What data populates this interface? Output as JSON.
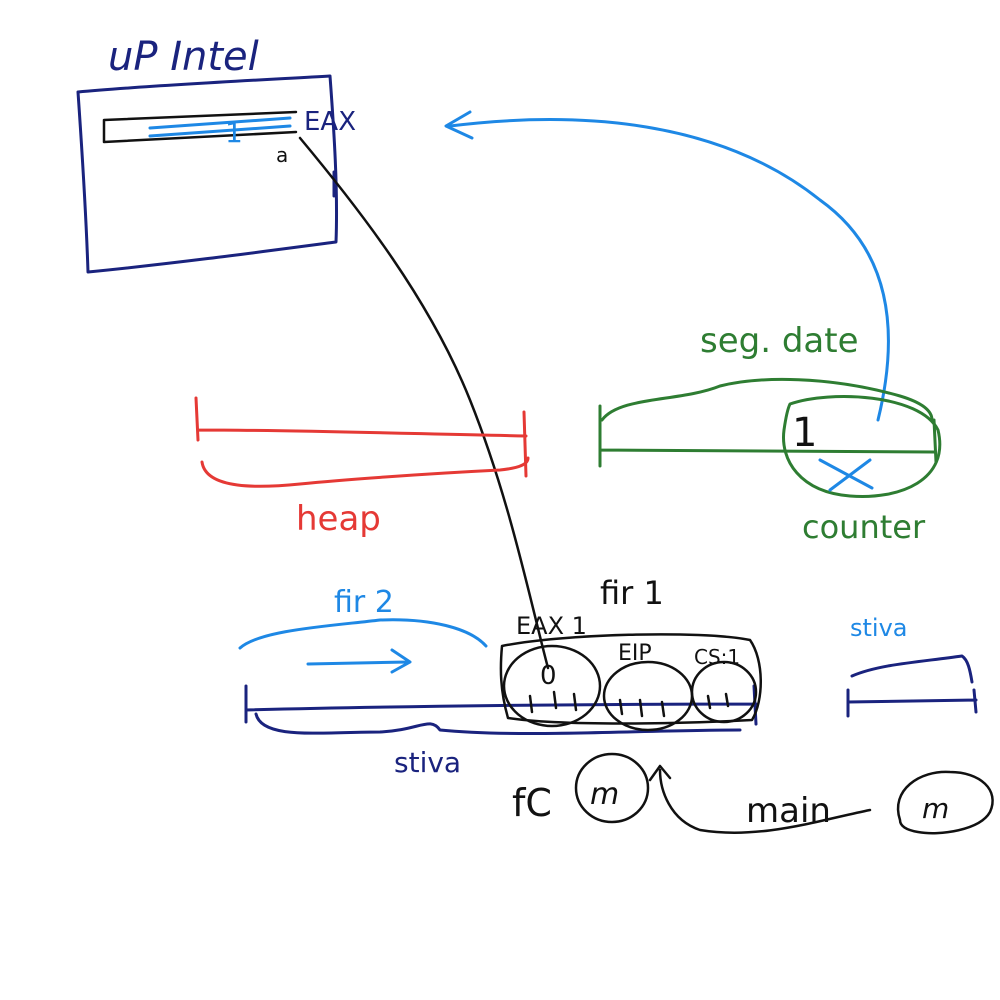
{
  "colors": {
    "navy": "#1a237e",
    "blue": "#1e88e5",
    "red": "#e53935",
    "green": "#2e7d32",
    "black": "#111111",
    "background": "#ffffff"
  },
  "cpu": {
    "title": "uP Intel",
    "register_name": "EAX",
    "register_value": "1",
    "pointer_mark": "a"
  },
  "heap": {
    "label": "heap"
  },
  "data_segment": {
    "label": "seg. date",
    "cell_value": "1",
    "variable_name": "counter"
  },
  "stack_main": {
    "label": "stiva",
    "thread2_label": "fir 2",
    "thread1_label": "fir 1",
    "frame1_value": "0",
    "frame1_reg_label": "EAX 1",
    "frame2_label": "EIP",
    "frame3_label": "CS:1"
  },
  "stack_small": {
    "label": "stiva"
  },
  "calls": {
    "fc_label": "fC",
    "m_label": "m",
    "main_label": "main",
    "main_m_label": "m"
  }
}
